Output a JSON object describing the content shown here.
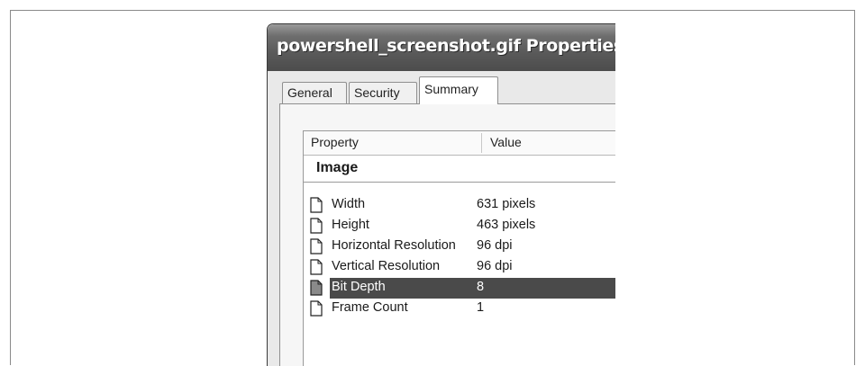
{
  "dialog": {
    "title": "powershell_screenshot.gif Properties",
    "tabs": [
      {
        "label": "General"
      },
      {
        "label": "Security"
      },
      {
        "label": "Summary"
      }
    ],
    "active_tab": "Summary"
  },
  "list": {
    "columns": [
      "Property",
      "Value"
    ],
    "group": "Image",
    "rows": [
      {
        "property": "Width",
        "value": "631 pixels"
      },
      {
        "property": "Height",
        "value": "463 pixels"
      },
      {
        "property": "Horizontal Resolution",
        "value": "96 dpi"
      },
      {
        "property": "Vertical Resolution",
        "value": "96 dpi"
      },
      {
        "property": "Bit Depth",
        "value": "8"
      },
      {
        "property": "Frame Count",
        "value": "1"
      }
    ],
    "selected_row": "Bit Depth"
  },
  "icons": {
    "row_icon": "document-icon"
  },
  "colors": {
    "titlebar": "#5a5a5a",
    "selection": "#4a4a4a"
  }
}
